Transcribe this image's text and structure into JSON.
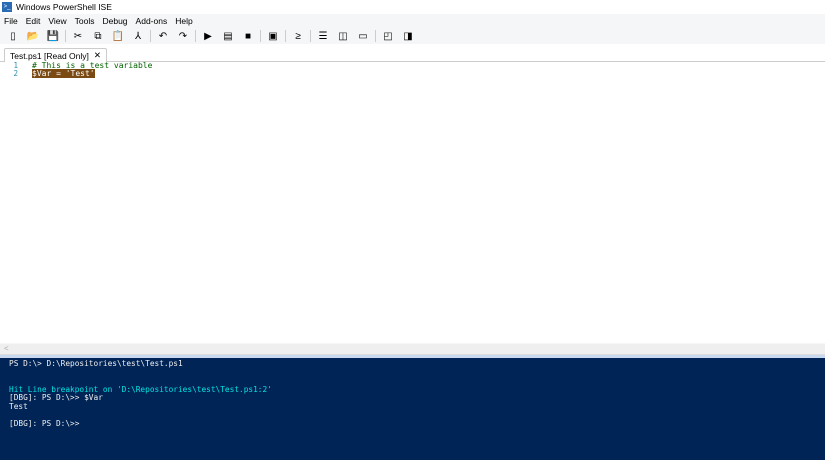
{
  "window": {
    "title": "Windows PowerShell ISE"
  },
  "menu": [
    "File",
    "Edit",
    "View",
    "Tools",
    "Debug",
    "Add-ons",
    "Help"
  ],
  "toolbar": [
    {
      "icon": "new-icon",
      "glyph": "▯"
    },
    {
      "icon": "open-icon",
      "glyph": "📂"
    },
    {
      "icon": "save-icon",
      "glyph": "💾"
    },
    {
      "sep": true
    },
    {
      "icon": "cut-icon",
      "glyph": "✂"
    },
    {
      "icon": "copy-icon",
      "glyph": "⧉"
    },
    {
      "icon": "paste-icon",
      "glyph": "📋"
    },
    {
      "icon": "clear-console-icon",
      "glyph": "⅄"
    },
    {
      "sep": true
    },
    {
      "icon": "undo-icon",
      "glyph": "↶"
    },
    {
      "icon": "redo-icon",
      "glyph": "↷"
    },
    {
      "sep": true
    },
    {
      "icon": "run-icon",
      "glyph": "▶"
    },
    {
      "icon": "run-selection-icon",
      "glyph": "▤"
    },
    {
      "icon": "stop-icon",
      "glyph": "■"
    },
    {
      "sep": true
    },
    {
      "icon": "remote-powershell-icon",
      "glyph": "▣"
    },
    {
      "sep": true
    },
    {
      "icon": "powershell-console-icon",
      "glyph": "≥"
    },
    {
      "sep": true
    },
    {
      "icon": "layout-top-icon",
      "glyph": "☰"
    },
    {
      "icon": "layout-right-icon",
      "glyph": "◫"
    },
    {
      "icon": "layout-max-icon",
      "glyph": "▭"
    },
    {
      "sep": true
    },
    {
      "icon": "show-script-pane-icon",
      "glyph": "◰"
    },
    {
      "icon": "show-commands-icon",
      "glyph": "◨"
    }
  ],
  "tab": {
    "label": "Test.ps1 [Read Only]",
    "close": "✕"
  },
  "editor": {
    "lines": [
      {
        "num": "1",
        "text": "# This is a test variable",
        "type": "comment"
      },
      {
        "num": "2",
        "text": "$Var = 'Test'",
        "type": "highlight"
      }
    ]
  },
  "scroll": {
    "left_arrow": "<"
  },
  "console": {
    "l1": "PS D:\\> D:\\Repositories\\test\\Test.ps1",
    "l2": "Hit Line breakpoint on 'D:\\Repositories\\test\\Test.ps1:2'",
    "l3": "[DBG]: PS D:\\>> $Var",
    "l4": "Test",
    "l5": "[DBG]: PS D:\\>>"
  },
  "colors": {
    "console_bg": "#012456",
    "highlight": "#7a4a12"
  }
}
